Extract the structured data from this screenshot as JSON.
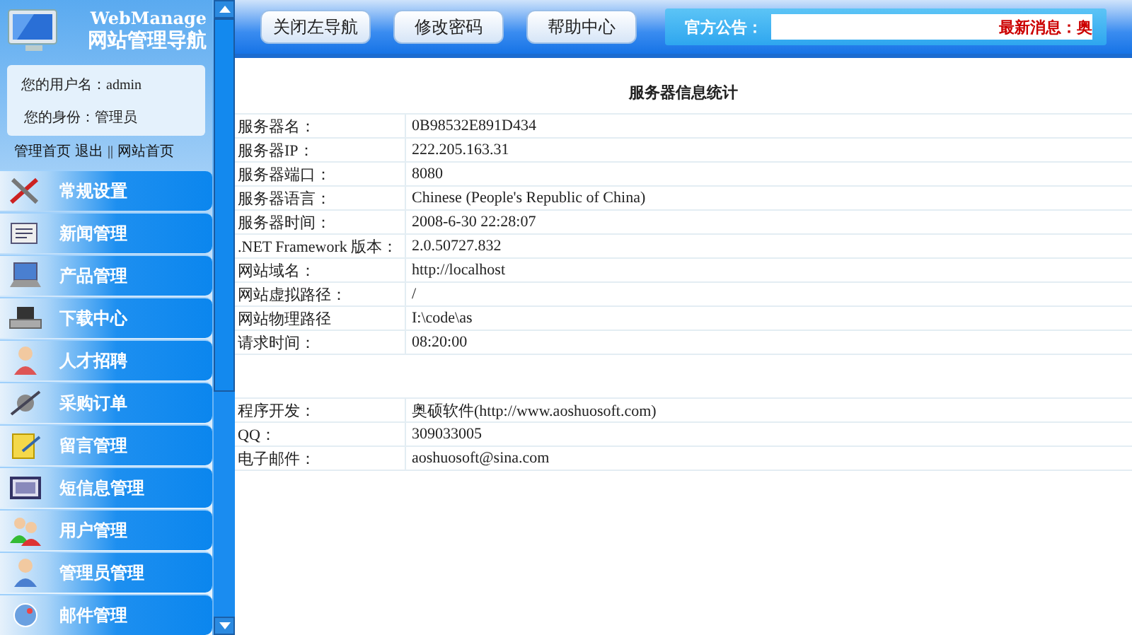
{
  "sidebar": {
    "brand": "WebManage",
    "title": "网站管理导航",
    "user": {
      "username_label": "您的用户名：",
      "username": "admin",
      "role_label": "您的身份：",
      "role": "管理员"
    },
    "links": [
      {
        "label": "管理首页"
      },
      {
        "label": "退出"
      },
      {
        "label": "网站首页",
        "separator": "||"
      }
    ],
    "menu": [
      {
        "label": "常规设置"
      },
      {
        "label": "新闻管理"
      },
      {
        "label": "产品管理"
      },
      {
        "label": "下载中心"
      },
      {
        "label": "人才招聘"
      },
      {
        "label": "采购订单"
      },
      {
        "label": "留言管理"
      },
      {
        "label": "短信息管理"
      },
      {
        "label": "用户管理"
      },
      {
        "label": "管理员管理"
      },
      {
        "label": "邮件管理"
      }
    ]
  },
  "toolbar": {
    "buttons": [
      "关闭左导航",
      "修改密码",
      "帮助中心"
    ],
    "notice_label": "官方公告：",
    "notice": "最新消息：奥"
  },
  "content": {
    "title": "服务器信息统计",
    "rows": [
      {
        "label": "服务器名：",
        "value": "0B98532E891D434"
      },
      {
        "label": "服务器IP：",
        "value": "222.205.163.31"
      },
      {
        "label": "服务器端口：",
        "value": "8080"
      },
      {
        "label": "服务器语言：",
        "value": "Chinese (People's Republic of China)"
      },
      {
        "label": "服务器时间：",
        "value": "2008-6-30 22:28:07"
      },
      {
        "label": ".NET Framework 版本：",
        "value": " 2.0.50727.832"
      },
      {
        "label": " 网站域名：",
        "value": "http://localhost"
      },
      {
        "label": "网站虚拟路径：",
        "value": "/"
      },
      {
        "label": "网站物理路径",
        "value": "I:\\code\\as"
      },
      {
        "label": "请求时间：",
        "value": "08:20:00"
      }
    ],
    "about": [
      {
        "label": "程序开发：",
        "value": "奥硕软件(http://www.aoshuosoft.com)"
      },
      {
        "label": "QQ：",
        "value": "309033005"
      },
      {
        "label": "电子邮件：",
        "value": "aoshuosoft@sina.com"
      }
    ]
  }
}
